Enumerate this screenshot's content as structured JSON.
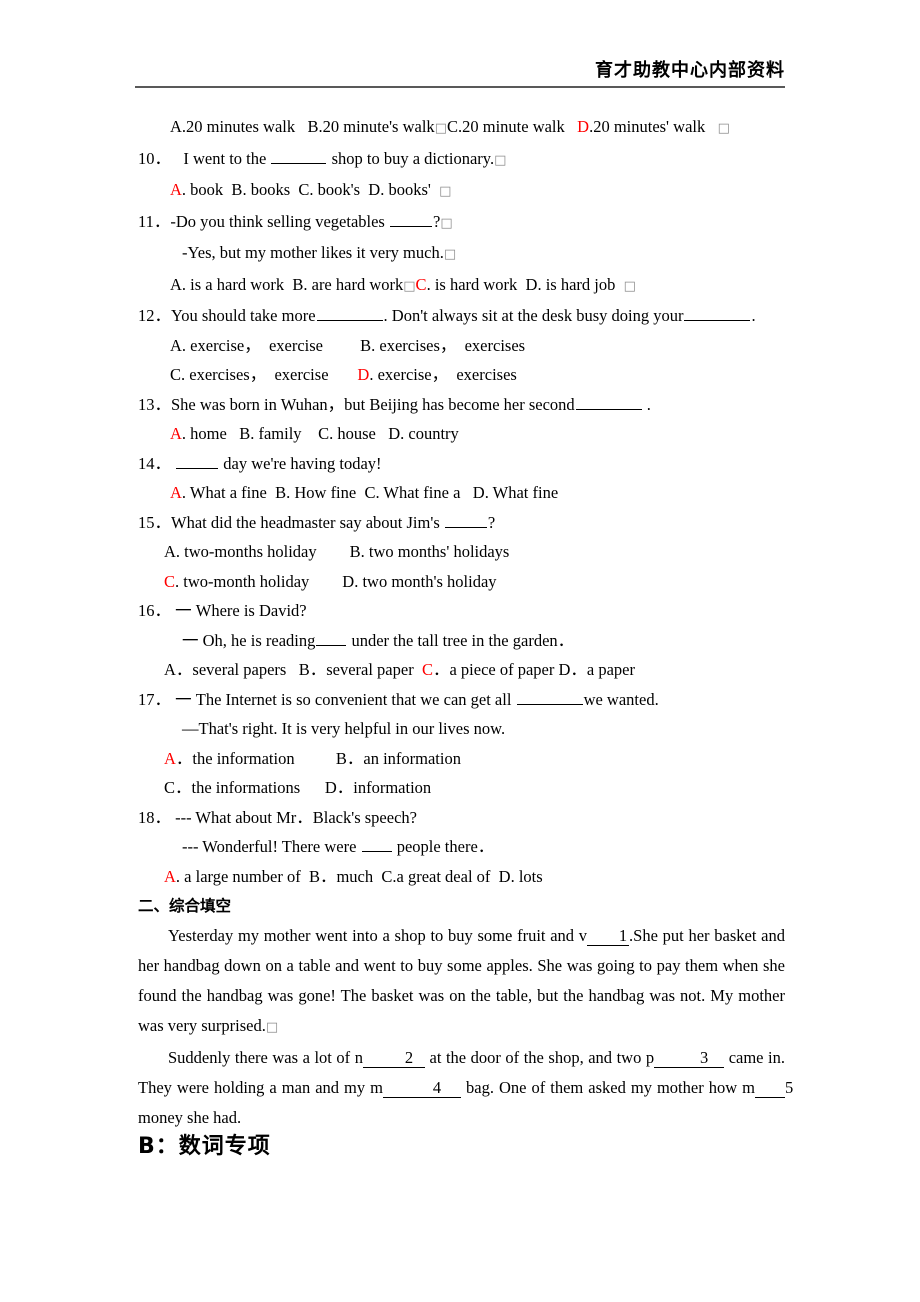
{
  "header": {
    "title": "育才助教中心内部资料"
  },
  "q9_options": {
    "a": "A.20 minutes walk",
    "b": "B.20 minute's walk",
    "box1": "□",
    "c": "C.20 minute walk",
    "d_letter": "D",
    "d_rest": ".20 minutes' walk",
    "box2": "□"
  },
  "questions": [
    {
      "num": "10．",
      "stem_before": "I went to the ",
      "stem_after": " shop to buy a dictionary.",
      "stem_box": "□",
      "options_line": [
        {
          "letter": "A",
          "red": true,
          "text": ". book"
        },
        {
          "letter": "B",
          "red": false,
          "text": ". books"
        },
        {
          "letter": "C",
          "red": false,
          "text": ". book's"
        },
        {
          "letter": "D",
          "red": false,
          "text": ". books'"
        }
      ],
      "trailing_box": "□"
    },
    {
      "num": "11．",
      "stem_before": "-Do you think selling vegetables ",
      "stem_after": "?",
      "stem_box": "□",
      "second_line": "-Yes, but my mother likes it very much.",
      "second_box": "□",
      "options_raw": {
        "a": "A. is a hard work",
        "b": "B. are hard work",
        "box_mid": "□",
        "c_letter": "C",
        "c_rest": ". is hard work",
        "d": "D. is hard job",
        "box_end": "□"
      }
    },
    {
      "num": "12．",
      "stem_p1": "You should take more",
      "stem_p2": ". Don't always sit at the desk busy doing your",
      "stem_p3": ".",
      "opt_row1_a": "A. exercise，  exercise",
      "opt_row1_b": "B. exercises，  exercises",
      "opt_row2_c": "C. exercises，  exercise",
      "opt_row2_d_letter": "D",
      "opt_row2_d_rest": ". exercise，  exercises"
    },
    {
      "num": "13．",
      "stem_before": "She was born in Wuhan，but Beijing has become her second",
      "stem_after": " .",
      "options_line": [
        {
          "letter": "A",
          "red": true,
          "text": ". home"
        },
        {
          "letter": "B",
          "red": false,
          "text": ". family"
        },
        {
          "letter": "C",
          "red": false,
          "text": ". house"
        },
        {
          "letter": "D",
          "red": false,
          "text": ". country"
        }
      ]
    },
    {
      "num": "14．",
      "stem_after": " day we're having today!",
      "options_line": [
        {
          "letter": "A",
          "red": true,
          "text": ". What a fine"
        },
        {
          "letter": "B",
          "red": false,
          "text": ". How fine"
        },
        {
          "letter": "C",
          "red": false,
          "text": ". What fine a"
        },
        {
          "letter": "D",
          "red": false,
          "text": ". What fine"
        }
      ]
    },
    {
      "num": "15．",
      "stem_before": "What did the headmaster say about Jim's ",
      "stem_after": "?",
      "opt_a": "A. two-months holiday",
      "opt_b": "B. two months' holidays",
      "opt_c_letter": "C",
      "opt_c_rest": ". two-month holiday",
      "opt_d": "D. two month's holiday"
    },
    {
      "num": "16．",
      "dash": "一",
      "line1": " Where is David?",
      "line2_before": " Oh, he is reading",
      "line2_after": " under the tall tree in the garden．",
      "opt_a": "A．several papers",
      "opt_b": "B．several paper",
      "opt_c_letter": "C",
      "opt_c_rest": "．a piece of paper",
      "opt_d": "D．a paper"
    },
    {
      "num": "17．",
      "dash": "一",
      "line1_before": " The Internet is so convenient that we can get all ",
      "line1_after": "we wanted.",
      "line2": "—That's right. It is very helpful in our lives now.",
      "opt_a_letter": "A",
      "opt_a_rest": "．the information",
      "opt_b": "B．an information",
      "opt_c": "C．the informations",
      "opt_d": "D．information"
    },
    {
      "num": "18．",
      "line1": "--- What about Mr．Black's speech?",
      "line2_before": "--- Wonderful! There were ",
      "line2_after": " people there．",
      "opt_a_letter": "A",
      "opt_a_rest": ". a large number of",
      "opt_b": "B．much",
      "opt_c": "C.a great deal of",
      "opt_d": "D. lots"
    }
  ],
  "section2": {
    "heading": "二、综合填空",
    "para1_part1": "Yesterday my mother went into a shop to buy some fruit and v",
    "cloze1": "1",
    "para1_part2": ".She put her basket and her handbag down on a table and went to buy some apples. She was going to pay them when she found the handbag was gone! The basket was on the table, but the handbag was not. My mother was very surprised.",
    "para1_box": "□",
    "para2_part1": "Suddenly there was a lot of n",
    "cloze2": "2",
    "para2_part2": " at the door of the shop, and two p",
    "cloze3": "3",
    "para2_part3": " came in. They were holding a man and my m",
    "cloze4": "4",
    "para2_part4": " bag. One of them asked my mother how m",
    "cloze5": "5",
    "para2_part5": " money she had."
  },
  "big_heading": "B：数词专项",
  "colors": {
    "answer_red": "#FF0000",
    "rule_gray": "#595959",
    "box_gray": "#8c8c8c"
  }
}
